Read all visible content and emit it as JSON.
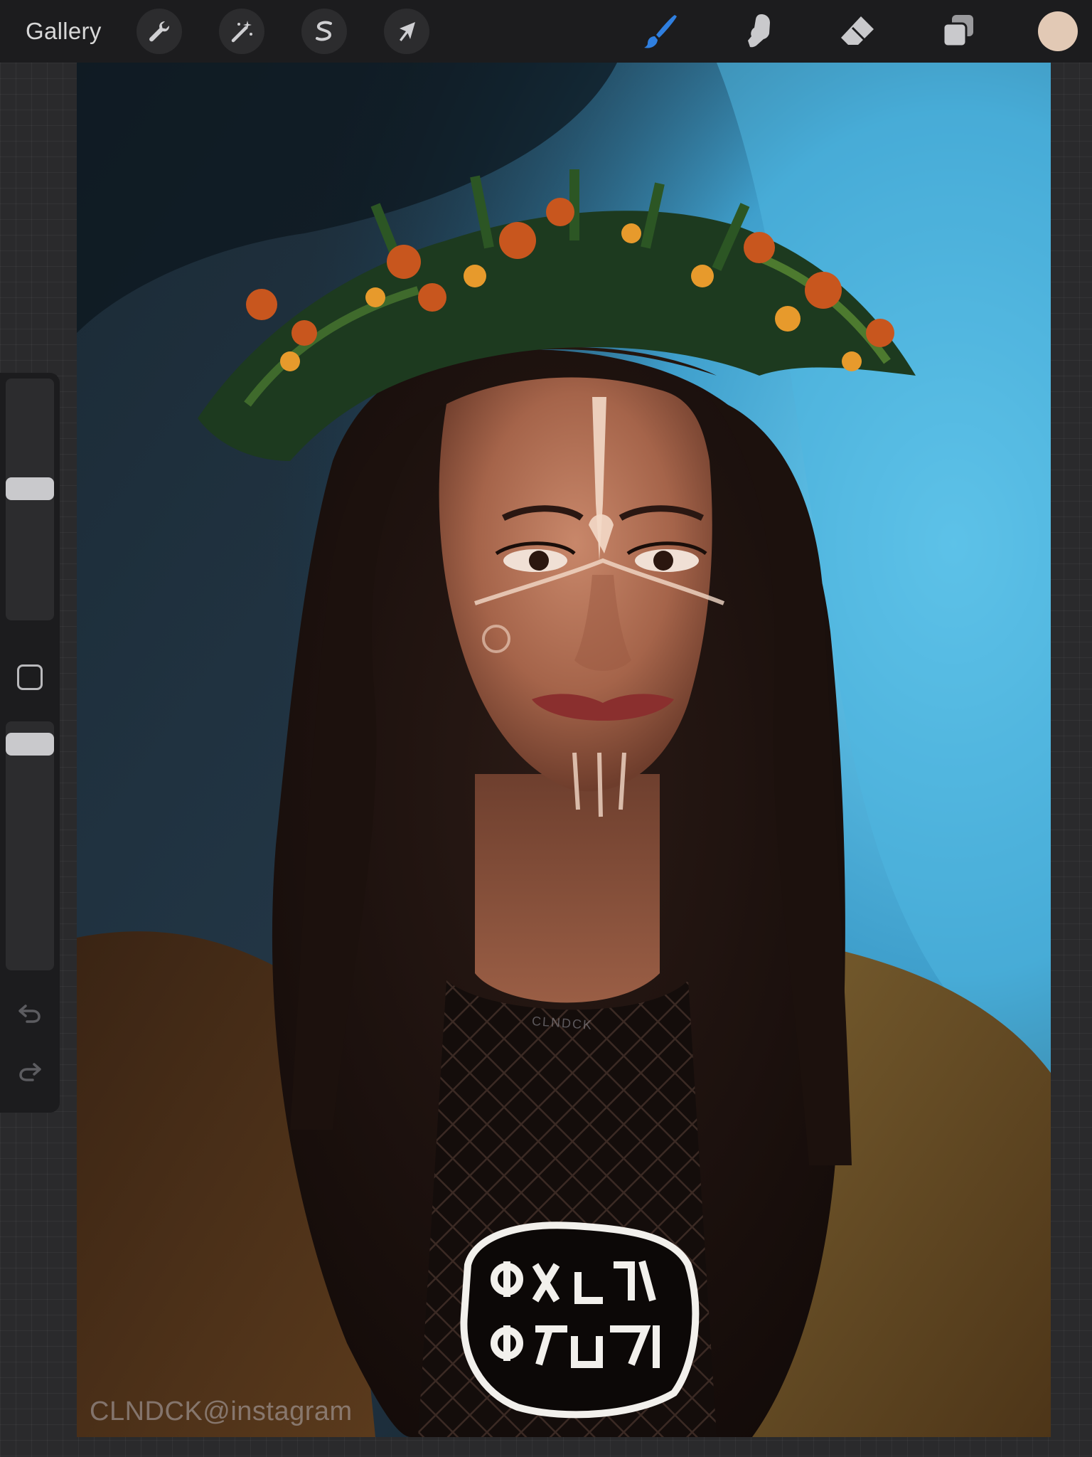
{
  "toolbar": {
    "gallery_label": "Gallery",
    "left_tools": [
      {
        "name": "actions",
        "icon": "wrench-icon"
      },
      {
        "name": "adjustments",
        "icon": "magic-wand-icon"
      },
      {
        "name": "selection",
        "icon": "selection-s-icon"
      },
      {
        "name": "transform",
        "icon": "arrow-cursor-icon"
      }
    ],
    "right_tools": [
      {
        "name": "brush",
        "icon": "brush-icon",
        "active": true
      },
      {
        "name": "smudge",
        "icon": "smudge-icon",
        "active": false
      },
      {
        "name": "eraser",
        "icon": "eraser-icon",
        "active": false
      },
      {
        "name": "layers",
        "icon": "layers-icon",
        "active": false
      }
    ],
    "current_color": "#e2c9b5",
    "active_color": "#2f7fe0"
  },
  "sidebar": {
    "brush_size_level": 0.55,
    "opacity_level": 0.95,
    "modify_icon": "square-outline-icon",
    "undo_icon": "undo-icon",
    "redo_icon": "redo-icon"
  },
  "canvas": {
    "watermark": "CLNDCK@instagram",
    "shirt_label": "CLNDCK"
  }
}
